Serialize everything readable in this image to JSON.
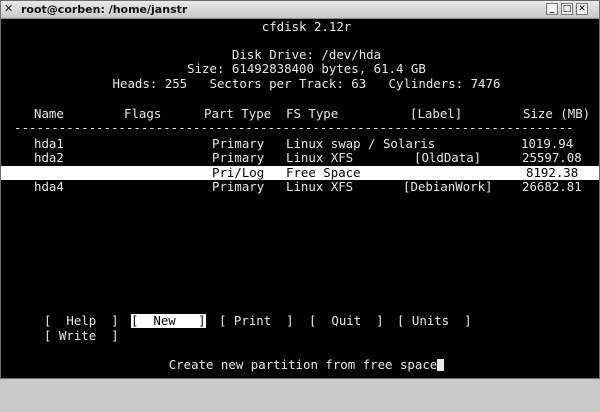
{
  "window": {
    "title": "root@corben: /home/janstr",
    "title_icon": "x-window-icon"
  },
  "header": {
    "app": "cfdisk 2.12r",
    "disk": "Disk Drive: /dev/hda",
    "size": "Size: 61492838400 bytes, 61.4 GB",
    "geometry": "Heads: 255   Sectors per Track: 63   Cylinders: 7476"
  },
  "columns": {
    "name": "Name",
    "flags": "Flags",
    "part_type": "Part Type",
    "fs_type": "FS Type",
    "label": "[Label]",
    "size": "Size (MB)"
  },
  "separator": "---------------------------------------------------------------------------",
  "partitions": [
    {
      "name": "hda1",
      "flags": "",
      "part_type": "Primary",
      "fs_type": "Linux swap / Solaris",
      "label": "",
      "size": "1019.94"
    },
    {
      "name": "hda2",
      "flags": "",
      "part_type": "Primary",
      "fs_type": "Linux XFS",
      "label": "[OldData]",
      "size": "25597.08"
    },
    {
      "name": "",
      "flags": "",
      "part_type": "Pri/Log",
      "fs_type": "Free Space",
      "label": "",
      "size": "8192.38",
      "selected": true
    },
    {
      "name": "hda4",
      "flags": "",
      "part_type": "Primary",
      "fs_type": "Linux XFS",
      "label": "[DebianWork]",
      "size": "26682.81"
    }
  ],
  "menu": {
    "help": "[  Help  ]",
    "new": "[  New   ]",
    "print": "[ Print  ]",
    "quit": "[  Quit  ]",
    "units": "[ Units  ]",
    "write": "[ Write  ]"
  },
  "status": "Create new partition from free space"
}
